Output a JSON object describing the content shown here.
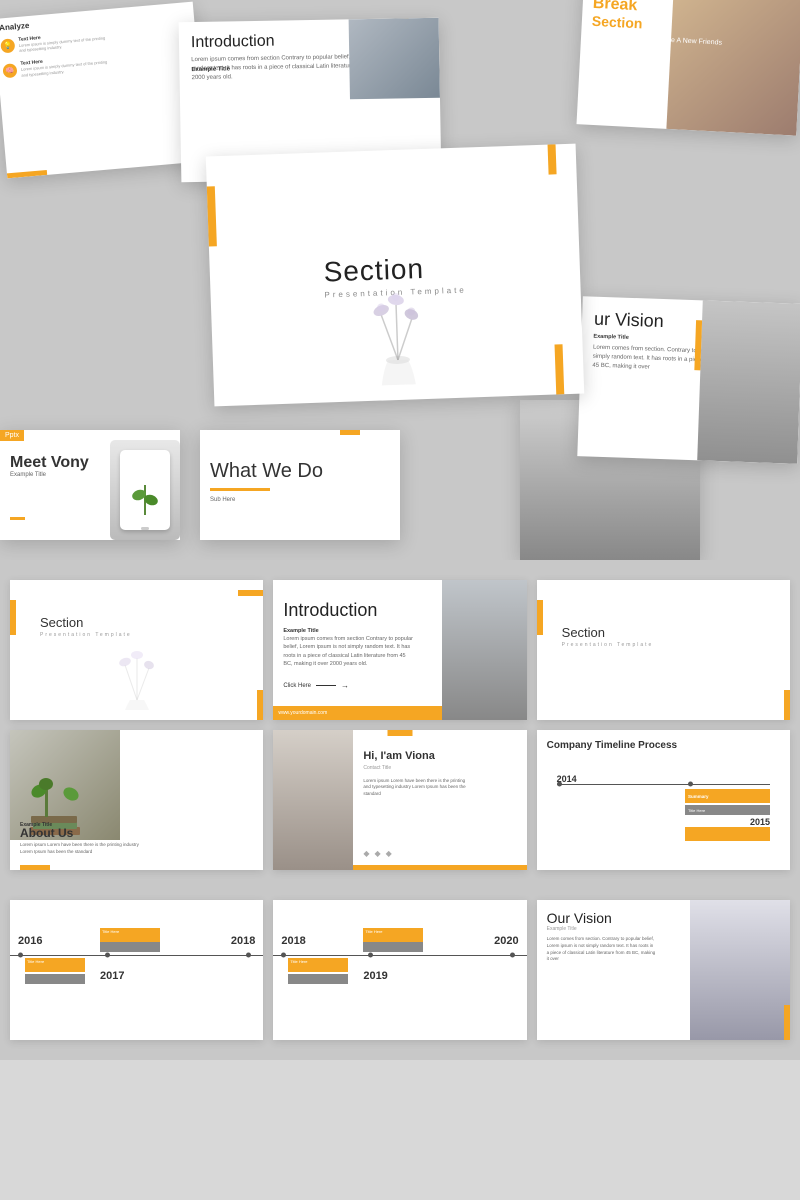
{
  "top": {
    "analyze_title": "Analyze",
    "break_title": "Break",
    "break_section": "Section",
    "break_sub": "Grab Some Coffee & Make A New Friends",
    "intro_title": "Introduction",
    "intro_sub_title": "Example Title",
    "intro_body": "Lorem ipsum comes from section Contrary to popular belief, Lorem ipsum is not simply random text. It has roots in a piece of classical Latin literature from 45 BC, making it over 2000 years old.",
    "main_title": "Section",
    "main_subtitle": "Presentation Template",
    "vision_title": "ur Vision",
    "vision_sub": "Example Title",
    "vision_body": "Lorem comes from section. Contrary to popular belief, Lorem ipsum is not simply random text. It has roots in a piece of classical Latin literature from 45 BC, making it over",
    "meet_badge": "Pptx",
    "meet_title": "Meet Vony",
    "meet_sub": "Example Title",
    "whatwedo_title": "What We Do"
  },
  "middle": {
    "section1_title": "Section",
    "section1_sub": "Presentation Template",
    "intro_title": "Introduction",
    "intro_example": "Example Title",
    "intro_body": "Lorem ipsum comes from section Contrary to popular belief, Lorem ipsum is not simply random text. It has roots in a piece of classical Latin literature from 45 BC, making it over 2000 years old.",
    "intro_click": "Click Here",
    "intro_website": "www.yourdomain.com",
    "section2_title": "Section",
    "section2_sub": "Presentation Template",
    "about_title": "About Us",
    "about_example": "Example Title",
    "about_body": "Lorem ipsum Lorem have been there is the printing industry Lorem Ipsum has been the standard",
    "viona_title": "Hi, I'am Viona",
    "viona_sub": "Contact Title",
    "viona_body": "Lorem ipsum Lorem have been there is the printing and typesetting industry Lorem Ipsum has been the standard",
    "tl_title": "Company Timeline Process",
    "year_2014": "2014",
    "year_2015": "2015",
    "tl_summary": "Summary",
    "tl_title_here": "Title Here"
  },
  "bottom": {
    "year_2016": "2016",
    "year_2017": "2017",
    "year_2018_1": "2018",
    "year_2018_2": "2018",
    "year_2019": "2019",
    "year_2020": "2020",
    "our_vision_title": "Our Vision",
    "our_vision_sub": "Example Title",
    "our_vision_body": "Lorem comes from section. Contrary to popular belief, Lorem ipsum is not simply random text. It has roots in a piece of classical Latin literature from 45 BC, making it over"
  }
}
